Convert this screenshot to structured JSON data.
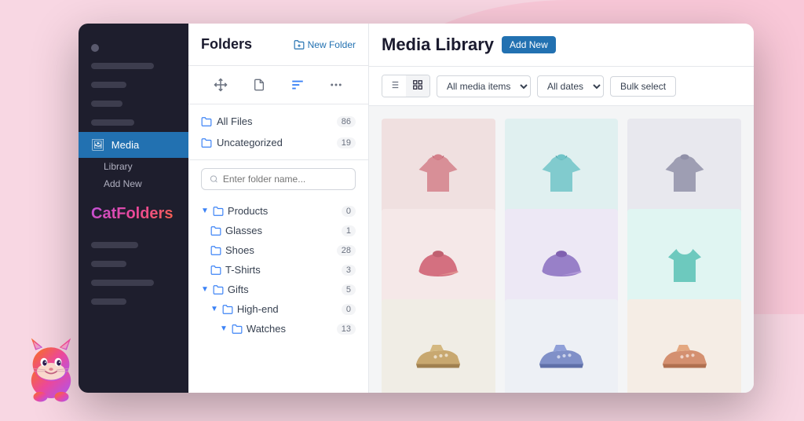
{
  "background": {
    "color": "#f8d7e3"
  },
  "sidebar": {
    "brand": "CatFolders",
    "media_label": "Media",
    "library_label": "Library",
    "add_new_label": "Add New"
  },
  "folders_panel": {
    "title": "Folders",
    "new_folder_btn": "New Folder",
    "search_placeholder": "Enter folder name...",
    "all_files": {
      "label": "All Files",
      "count": "86"
    },
    "uncategorized": {
      "label": "Uncategorized",
      "count": "19"
    },
    "tree": [
      {
        "label": "Products",
        "count": "0",
        "level": 0,
        "expanded": true
      },
      {
        "label": "Glasses",
        "count": "1",
        "level": 1
      },
      {
        "label": "Shoes",
        "count": "28",
        "level": 1
      },
      {
        "label": "T-Shirts",
        "count": "3",
        "level": 1
      },
      {
        "label": "Gifts",
        "count": "5",
        "level": 0,
        "expanded": true
      },
      {
        "label": "High-end",
        "count": "0",
        "level": 1,
        "expanded": true
      },
      {
        "label": "Watches",
        "count": "13",
        "level": 2
      }
    ]
  },
  "media_library": {
    "title": "Media Library",
    "add_new_btn": "Add New",
    "filters": {
      "media_items_label": "All media items",
      "dates_label": "All dates"
    },
    "bulk_select_btn": "Bulk select",
    "items": [
      {
        "type": "hoodie",
        "color": "pink",
        "alt": "Pink hoodie"
      },
      {
        "type": "hoodie",
        "color": "teal",
        "alt": "Teal hoodie"
      },
      {
        "type": "hoodie",
        "color": "gray",
        "alt": "Gray hoodie"
      },
      {
        "type": "cap",
        "color": "pink",
        "alt": "Pink cap"
      },
      {
        "type": "cap",
        "color": "purple",
        "alt": "Purple cap"
      },
      {
        "type": "tshirt",
        "color": "teal",
        "alt": "Teal t-shirt"
      },
      {
        "type": "shoes",
        "color": "multicolor",
        "alt": "Shoes"
      },
      {
        "type": "shoes",
        "color": "multicolor2",
        "alt": "Shoes 2"
      },
      {
        "type": "shoes",
        "color": "multicolor3",
        "alt": "Shoes 3"
      }
    ]
  }
}
